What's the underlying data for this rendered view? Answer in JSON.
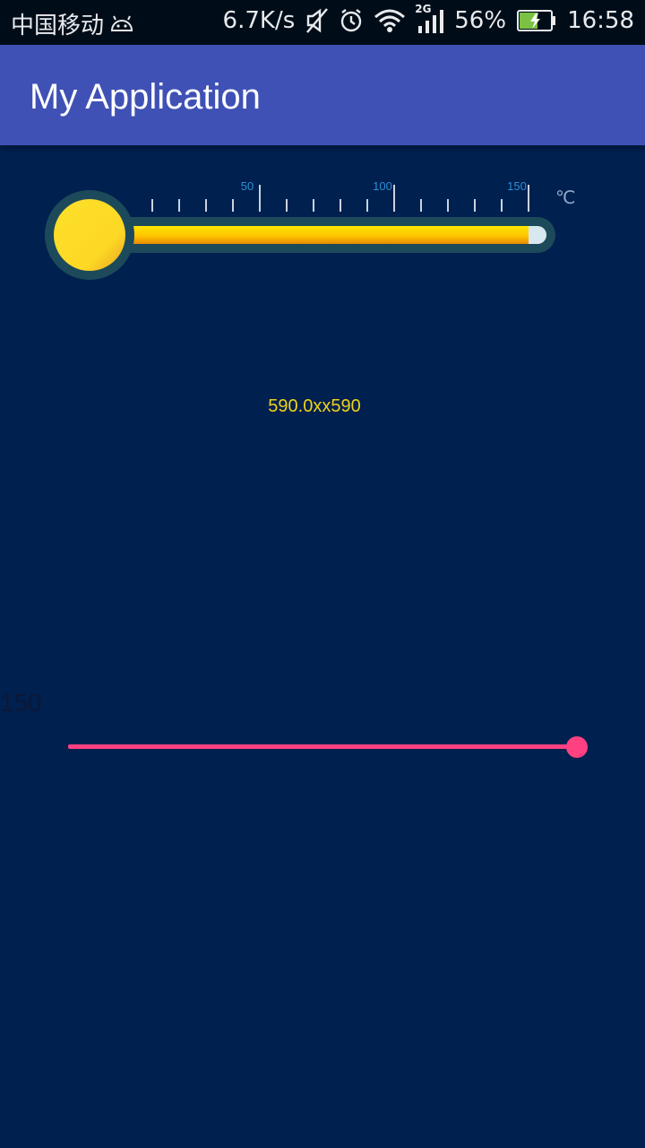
{
  "status_bar": {
    "carrier": "中国移动",
    "net_speed": "6.7K/s",
    "network_type": "2G",
    "battery_percent": "56%",
    "time": "16:58",
    "icons": [
      "android-debug-icon",
      "mute-icon",
      "alarm-icon",
      "wifi-icon",
      "signal-icon",
      "battery-charging-icon"
    ]
  },
  "app_bar": {
    "title": "My Application",
    "color": "#3f51b5"
  },
  "thermometer": {
    "unit": "℃",
    "tick_labels": [
      "50",
      "100",
      "150"
    ],
    "min": 0,
    "max": 150,
    "value": 150,
    "colors": {
      "bulb": "#fdd825",
      "mercury": "#ffd000",
      "tube_border": "#1d4a5a",
      "tube_empty": "#d7e8f0",
      "tick": "#c8d4e0",
      "tick_label": "#2b8fd6"
    }
  },
  "readout": {
    "text": "590.0xx590"
  },
  "seekbar": {
    "value_label": "150",
    "progress": 1.0,
    "color": "#ff4081"
  },
  "background_color": "#00204f"
}
